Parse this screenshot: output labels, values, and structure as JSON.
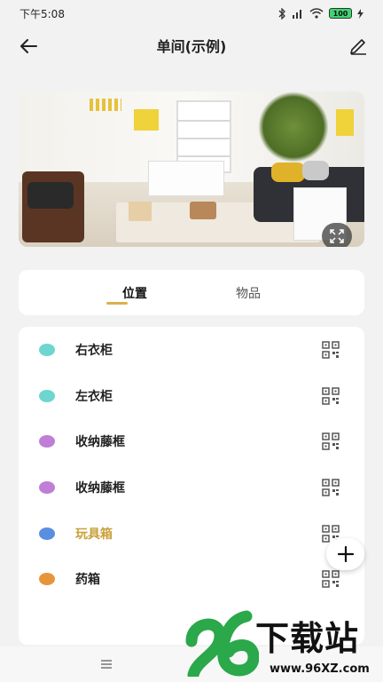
{
  "status_bar": {
    "time": "下午5:08",
    "battery": "100"
  },
  "header": {
    "title": "单间(示例)"
  },
  "tabs": [
    {
      "label": "位置",
      "active": true
    },
    {
      "label": "物品",
      "active": false
    }
  ],
  "locations": [
    {
      "label": "右衣柜",
      "color": "#6dd6cf"
    },
    {
      "label": "左衣柜",
      "color": "#6dd6cf"
    },
    {
      "label": "收纳藤框",
      "color": "#c07ed6"
    },
    {
      "label": "收纳藤框",
      "color": "#c07ed6"
    },
    {
      "label": "玩具箱",
      "color": "#5a8fe0",
      "highlight_color": "#c9a13a"
    },
    {
      "label": "药箱",
      "color": "#e8953a"
    }
  ],
  "watermark": {
    "title": "下载站",
    "url": "www.96XZ.com"
  },
  "colors": {
    "accent": "#d9b24a",
    "background": "#f2f2f2"
  }
}
